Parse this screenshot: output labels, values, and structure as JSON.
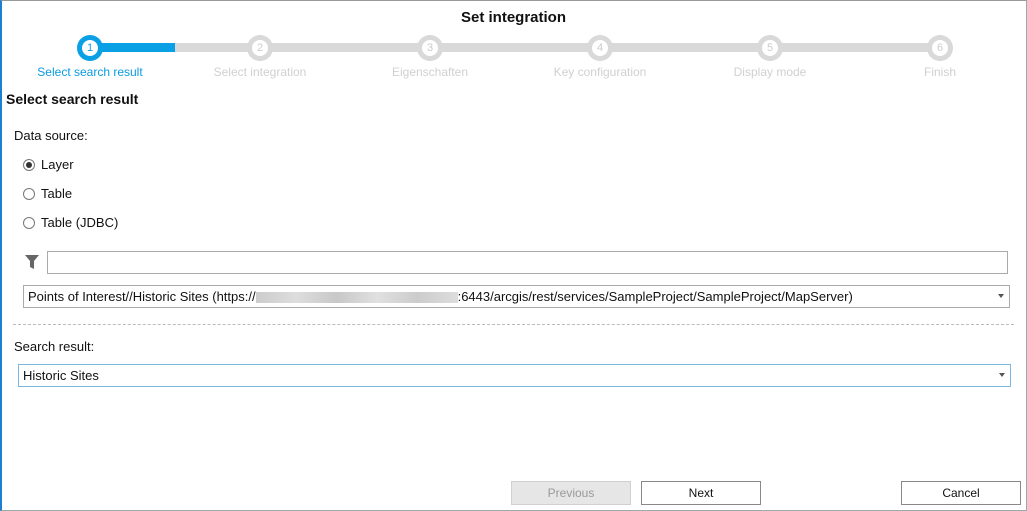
{
  "dialog": {
    "title": "Set integration"
  },
  "steps": [
    {
      "number": "1",
      "label": "Select search result",
      "active": true
    },
    {
      "number": "2",
      "label": "Select integration"
    },
    {
      "number": "3",
      "label": "Eigenschaften"
    },
    {
      "number": "4",
      "label": "Key configuration"
    },
    {
      "number": "5",
      "label": "Display mode"
    },
    {
      "number": "6",
      "label": "Finish"
    }
  ],
  "section_title": "Select search result",
  "data_source": {
    "label": "Data source:",
    "options": [
      "Layer",
      "Table",
      "Table (JDBC)"
    ],
    "selected": "Layer"
  },
  "filter": {
    "value": ""
  },
  "service": {
    "prefix": "Points of Interest//Historic Sites (https://",
    "suffix": ":6443/arcgis/rest/services/SampleProject/SampleProject/MapServer)"
  },
  "search_result": {
    "label": "Search result:",
    "value": "Historic Sites"
  },
  "buttons": {
    "previous": "Previous",
    "next": "Next",
    "cancel": "Cancel"
  }
}
